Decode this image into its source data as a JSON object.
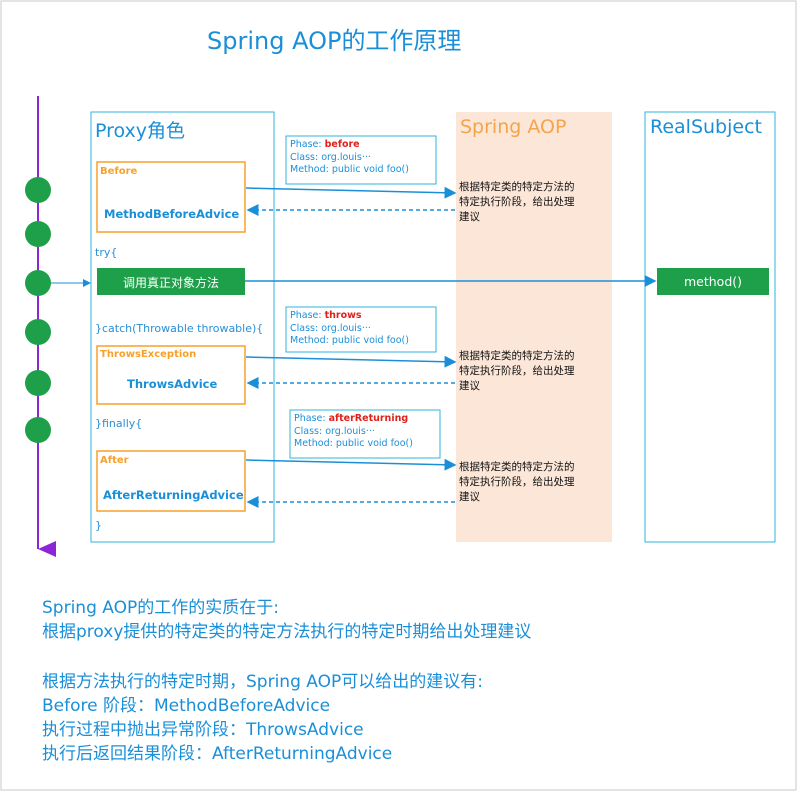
{
  "title": "Spring AOP的工作原理",
  "columns": {
    "proxy": "Proxy角色",
    "spring": "Spring AOP",
    "real": "RealSubject"
  },
  "code": {
    "try": "try{",
    "catch": "}catch(Throwable throwable){",
    "finally": "}finally{",
    "close": "}"
  },
  "invoke_label": "调用真正对象方法",
  "method_label": "method()",
  "advices": [
    {
      "label": "Before",
      "name": "MethodBeforeAdvice"
    },
    {
      "label": "ThrowsException",
      "name": "ThrowsAdvice"
    },
    {
      "label": "After",
      "name": "AfterReturningAdvice"
    }
  ],
  "phase_boxes": [
    {
      "phase_prefix": "Phase: ",
      "phase": "before",
      "class": "Class: org.louis···",
      "method": "Method: public void foo()"
    },
    {
      "phase_prefix": "Phase: ",
      "phase": "throws",
      "class": "Class: org.louis···",
      "method": "Method: public void foo()"
    },
    {
      "phase_prefix": "Phase: ",
      "phase": "afterReturning",
      "class": "Class: org.louis···",
      "method": "Method: public void foo()"
    }
  ],
  "notes": [
    {
      "line1": "根据特定类的特定方法的",
      "line2": "特定执行阶段，给出处理",
      "line3": "建议"
    },
    {
      "line1": "根据特定类的特定方法的",
      "line2": "特定执行阶段，给出处理",
      "line3": "建议"
    },
    {
      "line1": "根据特定类的特定方法的",
      "line2": "特定执行阶段，给出处理",
      "line3": "建议"
    }
  ],
  "summary": {
    "line1": "Spring AOP的工作的实质在于:",
    "line2": "根据proxy提供的特定类的特定方法执行的特定时期给出处理建议",
    "line3": "根据方法执行的特定时期，Spring AOP可以给出的建议有:",
    "line4": "Before 阶段：MethodBeforeAdvice",
    "line5": "执行过程中抛出异常阶段：ThrowsAdvice",
    "line6": "执行后返回结果阶段：AfterReturningAdvice"
  },
  "colors": {
    "blue": "#1a8fd8",
    "cyan_border": "#2fb6dd",
    "orange": "#f7a12b",
    "spring_bg": "#fbe6d8",
    "green": "#1ea04a",
    "purple": "#8e24d8",
    "red": "#e0201b"
  }
}
